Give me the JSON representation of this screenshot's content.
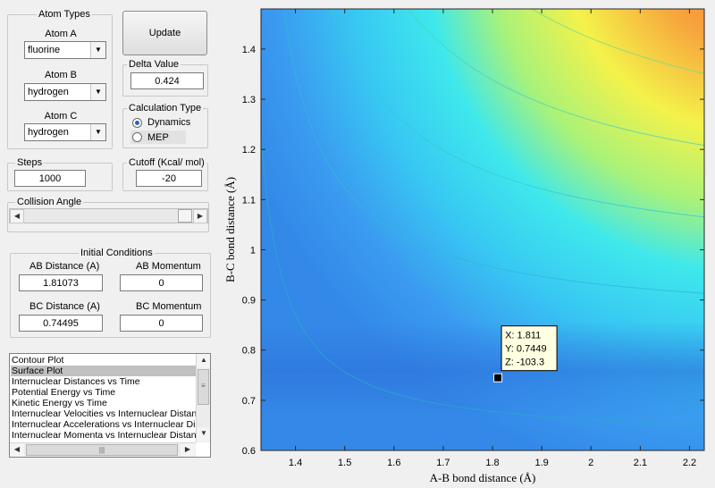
{
  "atom_types": {
    "title": "Atom Types",
    "atom_a": {
      "label": "Atom A",
      "value": "fluorine"
    },
    "atom_b": {
      "label": "Atom B",
      "value": "hydrogen"
    },
    "atom_c": {
      "label": "Atom C",
      "value": "hydrogen"
    }
  },
  "update_button": "Update",
  "delta_value": {
    "label": "Delta Value",
    "value": "0.424"
  },
  "calculation_type": {
    "title": "Calculation Type",
    "dynamics": "Dynamics",
    "mep": "MEP",
    "selected": "Dynamics"
  },
  "steps": {
    "label": "Steps",
    "value": "1000"
  },
  "cutoff": {
    "label": "Cutoff (Kcal/ mol)",
    "value": "-20"
  },
  "collision_angle": {
    "label": "Collision Angle"
  },
  "initial_conditions": {
    "title": "Initial Conditions",
    "ab_distance": {
      "label": "AB Distance (A)",
      "value": "1.81073"
    },
    "ab_momentum": {
      "label": "AB Momentum",
      "value": "0"
    },
    "bc_distance": {
      "label": "BC Distance (A)",
      "value": "0.74495"
    },
    "bc_momentum": {
      "label": "BC Momentum",
      "value": "0"
    }
  },
  "plot_list": {
    "items": [
      "Contour Plot",
      "Surface Plot",
      "Internuclear Distances vs Time",
      "Potential Energy vs Time",
      "Kinetic Energy vs Time",
      "Internuclear Velocities vs Internuclear Distance",
      "Internuclear Accelerations vs Internuclear Distance",
      "Internuclear Momenta vs Internuclear Distance"
    ],
    "selected": "Surface Plot"
  },
  "datatip": {
    "x": "X: 1.811",
    "y": "Y: 0.7449",
    "z": "Z: -103.3"
  },
  "chart_data": {
    "type": "heatmap",
    "title": "",
    "xlabel": "A-B bond distance (Å)",
    "ylabel": "B-C bond distance (Å)",
    "xlim": [
      1.33,
      2.23
    ],
    "ylim": [
      0.6,
      1.48
    ],
    "x_ticks": [
      1.4,
      1.5,
      1.6,
      1.7,
      1.8,
      1.9,
      2,
      2.1,
      2.2
    ],
    "y_ticks": [
      0.6,
      0.7,
      0.8,
      0.9,
      1,
      1.1,
      1.2,
      1.3,
      1.4
    ],
    "x_tick_labels": [
      "1.4",
      "1.5",
      "1.6",
      "1.7",
      "1.8",
      "1.9",
      "2",
      "2.1",
      "2.2"
    ],
    "y_tick_labels": [
      "0.6",
      "0.7",
      "0.8",
      "0.9",
      "1",
      "1.1",
      "1.2",
      "1.3",
      "1.4"
    ],
    "marker": {
      "x": 1.811,
      "y": 0.7449,
      "z": -103.3
    },
    "colormap": [
      "#2b6ed8",
      "#3a9bf0",
      "#3ee8ec",
      "#a8f27a",
      "#f4f24a",
      "#f7a23c",
      "#f07a3c"
    ]
  }
}
